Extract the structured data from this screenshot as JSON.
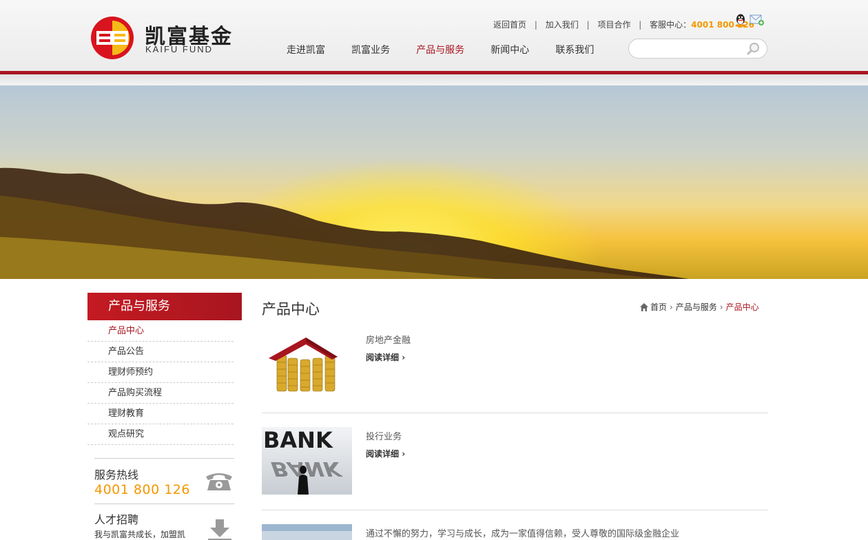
{
  "brand": {
    "cn": "凯富基金",
    "en": "KAIFU FUND"
  },
  "toplinks": {
    "home": "返回首页",
    "join": "加入我们",
    "partner": "项目合作",
    "service_label": "客服中心：",
    "service_number": "4001 800 126"
  },
  "nav": [
    {
      "label": "走进凯富"
    },
    {
      "label": "凯富业务"
    },
    {
      "label": "产品与服务"
    },
    {
      "label": "新闻中心"
    },
    {
      "label": "联系我们"
    }
  ],
  "search": {
    "placeholder": ""
  },
  "sidebar": {
    "title": "产品与服务",
    "items": [
      {
        "label": "产品中心"
      },
      {
        "label": "产品公告"
      },
      {
        "label": "理财师预约"
      },
      {
        "label": "产品购买流程"
      },
      {
        "label": "理财教育"
      },
      {
        "label": "观点研究"
      }
    ],
    "service": {
      "label": "服务热线",
      "number": "4001 800 126"
    },
    "recruit": {
      "label": "人才招聘",
      "desc": "我与凯富共成长，加盟凯"
    }
  },
  "main": {
    "title": "产品中心",
    "breadcrumb": [
      "首页",
      "产品与服务",
      "产品中心"
    ],
    "products": [
      {
        "name": "房地产金融",
        "more": "阅读详细"
      },
      {
        "name": "投行业务",
        "more": "阅读详细"
      },
      {
        "name": "通过不懈的努力，学习与成长，成为一家值得信赖，受人尊敬的国际级金融企业",
        "more": ""
      }
    ],
    "bank_text": "BANK"
  },
  "colors": {
    "brand_red": "#a8161f",
    "accent_orange": "#f39800"
  }
}
